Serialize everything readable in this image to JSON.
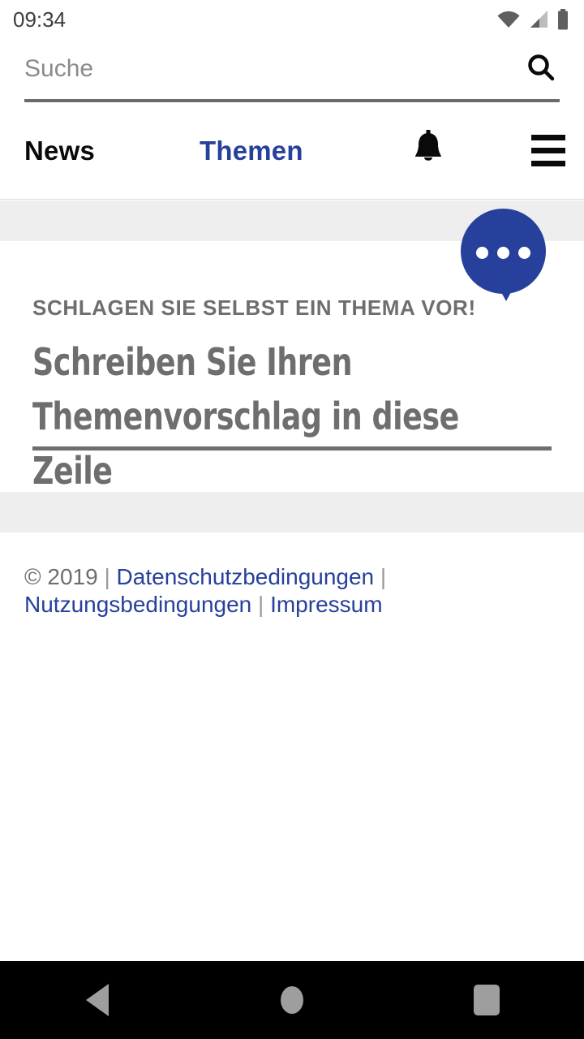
{
  "statusbar": {
    "time": "09:34",
    "icons": [
      "wifi-icon",
      "cellular-signal-icon",
      "battery-icon"
    ]
  },
  "search": {
    "placeholder": "Suche",
    "value": "",
    "icon": "search-icon"
  },
  "nav": {
    "news_label": "News",
    "themen_label": "Themen",
    "bell_icon": "bell-icon",
    "menu_icon": "hamburger-menu-icon",
    "active_color": "#27409b",
    "inactive_color": "#0a0a0a"
  },
  "promo": {
    "kicker": "SCHLAGEN SIE SELBST EIN THEMA VOR!",
    "headline_line1": "Schreiben Sie Ihren",
    "headline_line2": "Themenvorschlag in diese Zeile",
    "bubble_icon": "speech-bubble-icon",
    "bubble_color": "#27409b",
    "text_color": "#6e6e6e"
  },
  "footer": {
    "copyright": "© 2019",
    "separator": "|",
    "links": [
      {
        "label": "Datenschutzbedingungen"
      },
      {
        "label": "Nutzungsbedingungen"
      },
      {
        "label": "Impressum"
      }
    ],
    "link_color": "#27409b"
  },
  "androidnav": {
    "back_label": "back-button",
    "home_label": "home-button",
    "recents_label": "recents-button"
  }
}
